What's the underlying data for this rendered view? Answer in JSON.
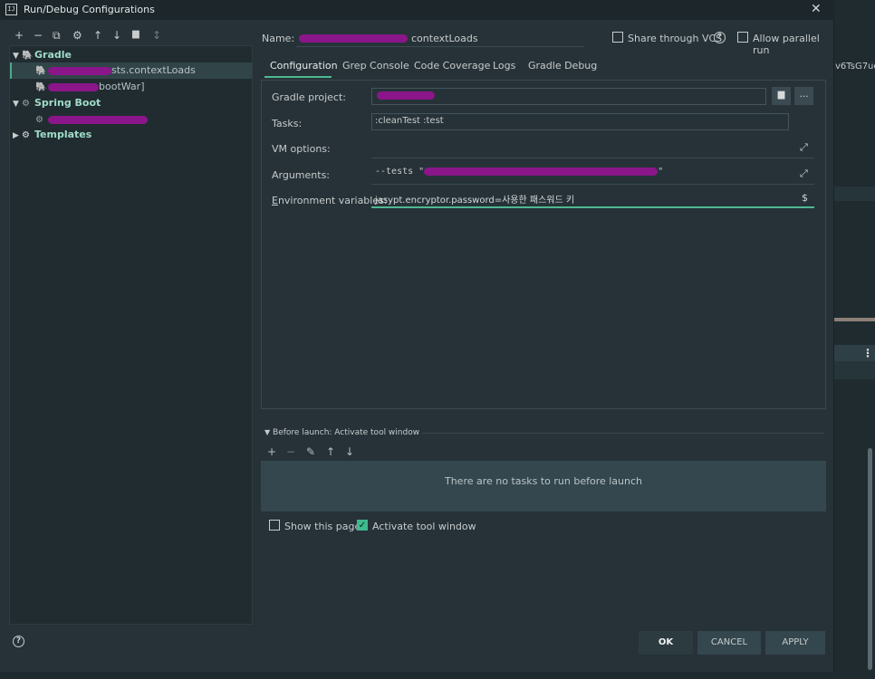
{
  "window": {
    "title": "Run/Debug Configurations",
    "close_glyph": "✕",
    "app_icon_text": "IJ"
  },
  "left_toolbar": {
    "icons": [
      "+",
      "−",
      "⧉",
      "⚙",
      "↑",
      "↓",
      "▆",
      "↕"
    ]
  },
  "tree": {
    "items": [
      {
        "label": "Gradle",
        "kind": "group"
      },
      {
        "label": "sts.contextLoads",
        "kind": "item",
        "selected": true
      },
      {
        "label": "bootWar]",
        "kind": "item"
      },
      {
        "label": "Spring Boot",
        "kind": "group"
      },
      {
        "label": "",
        "kind": "item"
      },
      {
        "label": "Templates",
        "kind": "group"
      }
    ]
  },
  "header": {
    "name_label": "Name:",
    "name_value": "contextLoads",
    "share_vcs_label": "Share through VCS",
    "allow_parallel_label": "Allow parallel run"
  },
  "tabs": [
    {
      "label": "Configuration",
      "active": true
    },
    {
      "label": "Grep Console"
    },
    {
      "label": "Code Coverage"
    },
    {
      "label": "Logs"
    },
    {
      "label": "Gradle Debug"
    }
  ],
  "form": {
    "gradle_project_label": "Gradle project:",
    "gradle_project_value": "",
    "tasks_label": "Tasks:",
    "tasks_value": ":cleanTest :test",
    "vm_options_label": "VM options:",
    "vm_options_value": "",
    "arguments_label": "Arguments:",
    "arguments_value": "--tests \"",
    "arguments_value_end": "\"",
    "env_label": "Environment variables:",
    "env_value": "jasypt.encryptor.password=사용한 패스워드 키",
    "browse_button": "…",
    "dollar": "$"
  },
  "before_launch": {
    "title": "Before launch: Activate tool window",
    "tools": [
      "+",
      "−",
      "✎",
      "↑",
      "↓"
    ],
    "empty_text": "There are no tasks to run before launch",
    "show_page_label": "Show this page",
    "activate_label": "Activate tool window"
  },
  "buttons": {
    "ok": "OK",
    "cancel": "CANCEL",
    "apply": "APPLY"
  },
  "backdrop": {
    "text": "v6TsG7uc",
    "menu": "⋮"
  }
}
